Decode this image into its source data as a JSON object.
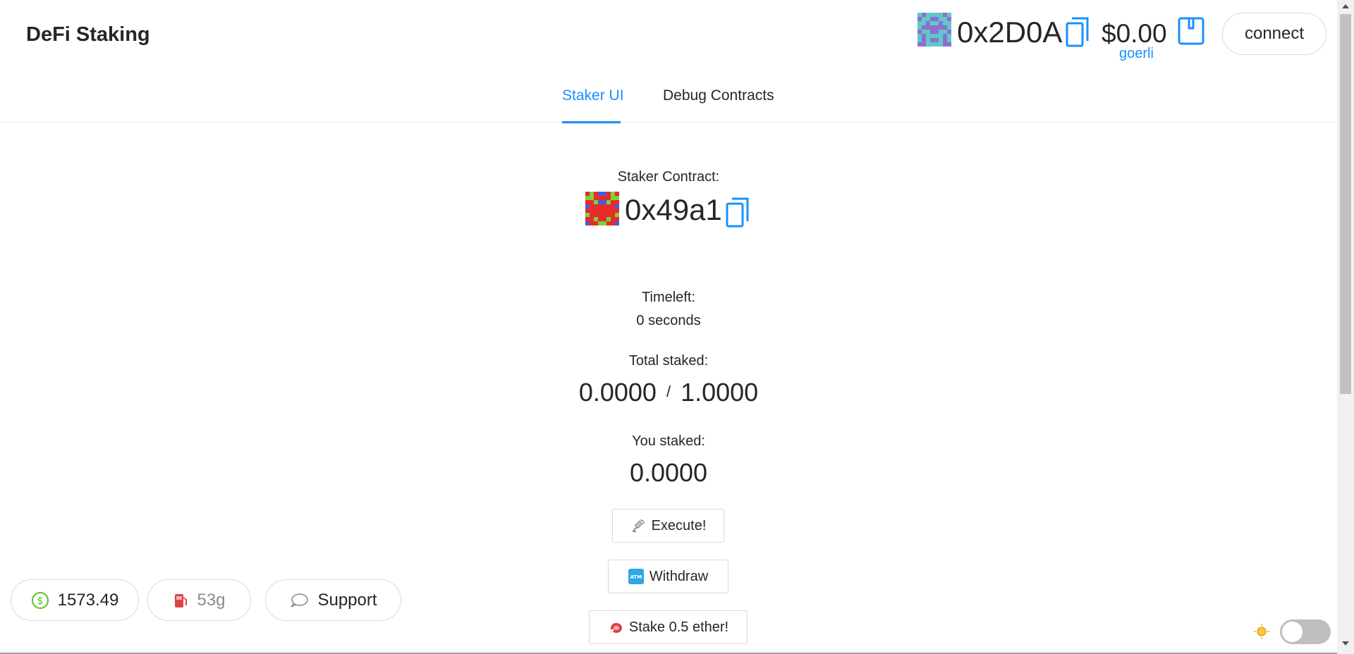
{
  "header": {
    "brand": "DeFi Staking",
    "account": {
      "address": "0x2D0A",
      "balance": "$0.00",
      "network": "goerli"
    },
    "connect_label": "connect"
  },
  "tabs": [
    {
      "label": "Staker UI",
      "active": true
    },
    {
      "label": "Debug Contracts",
      "active": false
    }
  ],
  "staker": {
    "contract_label": "Staker Contract:",
    "contract_address": "0x49a1",
    "timeleft_label": "Timeleft:",
    "timeleft_value": "0 seconds",
    "total_label": "Total staked:",
    "total_staked": "0.0000",
    "separator": "/",
    "threshold": "1.0000",
    "you_label": "You staked:",
    "you_staked": "0.0000"
  },
  "actions": {
    "execute": "Execute!",
    "withdraw": "Withdraw",
    "stake": "Stake 0.5 ether!"
  },
  "footer": {
    "price": "1573.49",
    "gas": "53g",
    "support": "Support"
  },
  "theme": {
    "mode": "light"
  },
  "colors": {
    "accent": "#1890ff",
    "text": "#262626",
    "border": "#d9d9d9"
  },
  "icons": {
    "copy": "copy-icon",
    "wallet": "wallet-icon",
    "execute": "satellite-icon",
    "withdraw": "atm-icon",
    "stake": "steak-icon",
    "price": "dollar-circle-icon",
    "gas": "fuel-pump-icon",
    "support": "comment-icon",
    "theme": "sun-icon"
  }
}
